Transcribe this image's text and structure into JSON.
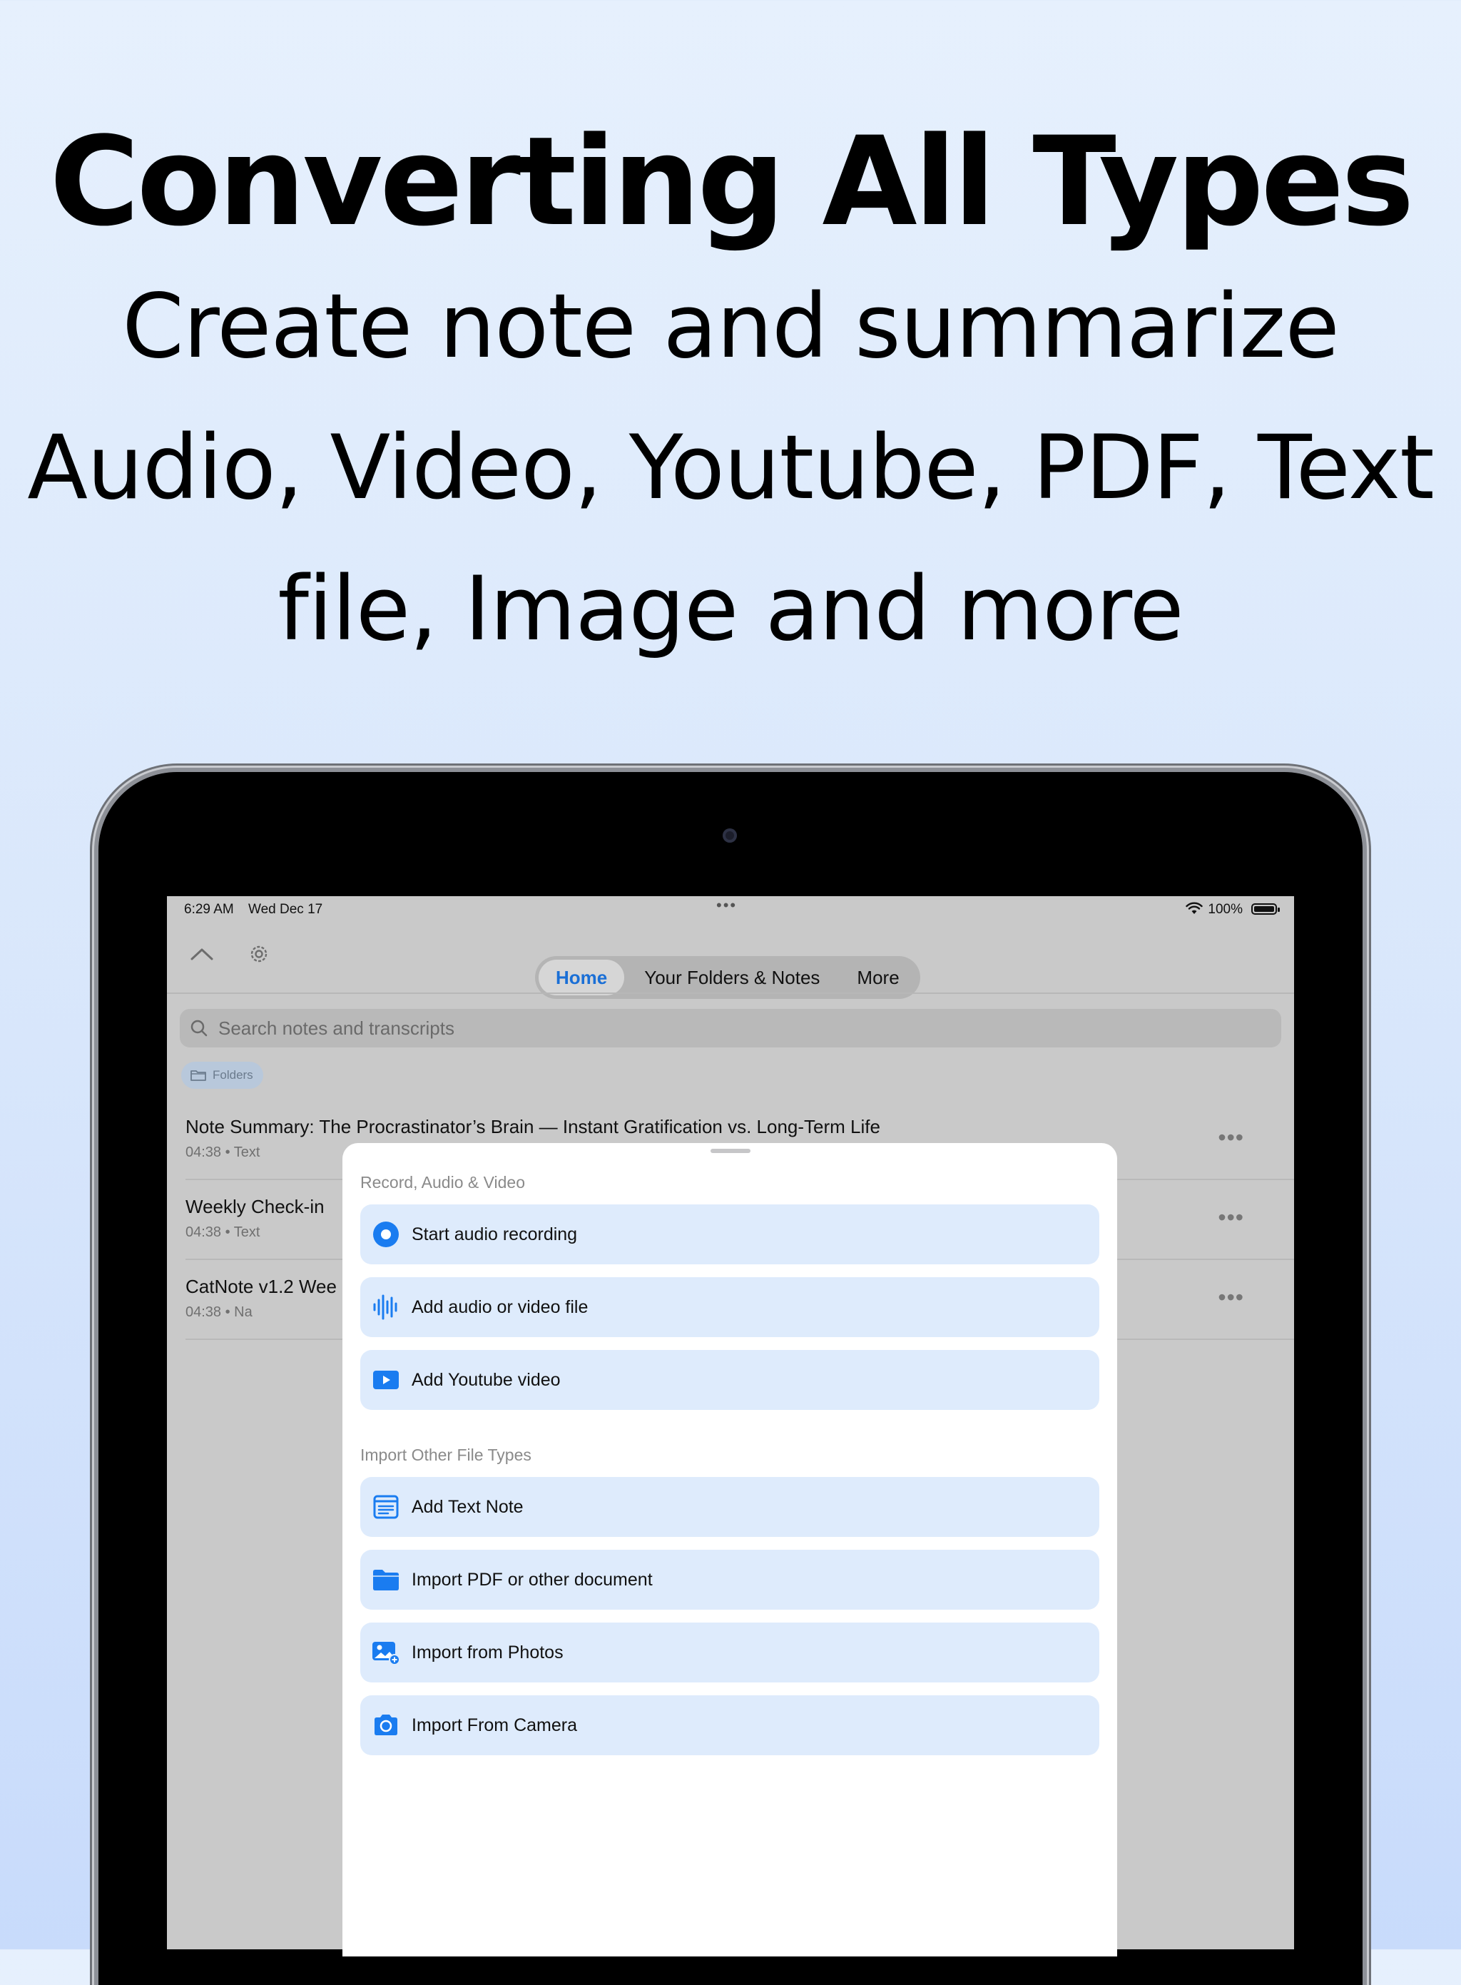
{
  "promo": {
    "headline": "Converting All Types",
    "lines": [
      "Create note and summarize",
      "Audio, Video, Youtube, PDF, Text",
      "file, Image and more"
    ]
  },
  "status_bar": {
    "time": "6:29 AM",
    "date": "Wed Dec 17",
    "dots": "•••",
    "battery": "100%"
  },
  "tabs": [
    {
      "label": "Home",
      "active": true
    },
    {
      "label": "Your Folders & Notes",
      "active": false
    },
    {
      "label": "More",
      "active": false
    }
  ],
  "search": {
    "placeholder": "Search notes and transcripts"
  },
  "folders_chip": "Folders",
  "notes": [
    {
      "title": "Note Summary: The Procrastinator’s Brain — Instant Gratification vs. Long-Term Life",
      "meta": "04:38 • Text"
    },
    {
      "title": "Weekly Check-in",
      "meta": "04:38 • Text"
    },
    {
      "title": "CatNote v1.2 Wee",
      "meta": "04:38 • Na"
    }
  ],
  "more_glyph": "•••",
  "sheet": {
    "section1": "Record, Audio & Video",
    "section2": "Import Other File Types",
    "options": [
      {
        "label": "Start audio recording",
        "icon": "record-icon"
      },
      {
        "label": "Add audio or video file",
        "icon": "waveform-icon"
      },
      {
        "label": "Add Youtube video",
        "icon": "youtube-play-icon"
      },
      {
        "label": "Add Text Note",
        "icon": "text-note-icon"
      },
      {
        "label": "Import PDF or other document",
        "icon": "folder-icon"
      },
      {
        "label": "Import from Photos",
        "icon": "photos-icon"
      },
      {
        "label": "Import From Camera",
        "icon": "camera-icon"
      }
    ]
  },
  "colors": {
    "accent": "#1a7cf0",
    "option_bg": "#deebfc",
    "background_top": "#e6f0fd",
    "background_bottom": "#c8dbfb"
  }
}
